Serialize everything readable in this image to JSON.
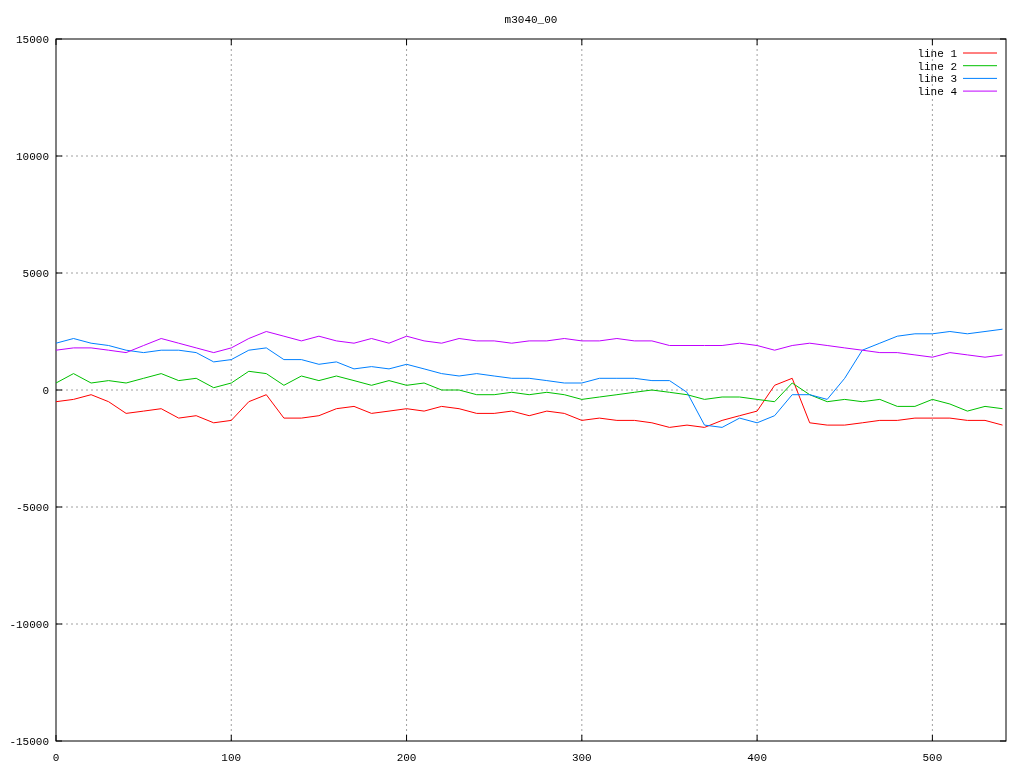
{
  "plot": {
    "chart_data": {
      "type": "line",
      "title": "m3040_00",
      "grid": true,
      "legend": true,
      "x": [
        0,
        10,
        20,
        30,
        40,
        50,
        60,
        70,
        80,
        90,
        100,
        110,
        120,
        130,
        140,
        150,
        160,
        170,
        180,
        190,
        200,
        210,
        220,
        230,
        240,
        250,
        260,
        270,
        280,
        290,
        300,
        310,
        320,
        330,
        340,
        350,
        360,
        370,
        380,
        390,
        400,
        410,
        420,
        430,
        440,
        450,
        460,
        470,
        480,
        490,
        500,
        510,
        520,
        530,
        540
      ],
      "xlim": [
        0,
        542
      ],
      "ylim": [
        -15000,
        15000
      ],
      "xticks": [
        0,
        100,
        200,
        300,
        400,
        500
      ],
      "yticks": [
        -15000,
        -10000,
        -5000,
        0,
        5000,
        10000,
        15000
      ],
      "series": [
        {
          "name": "line 1",
          "color": "#ff0000",
          "values": [
            -500,
            -400,
            -200,
            -500,
            -1000,
            -900,
            -800,
            -1200,
            -1100,
            -1400,
            -1300,
            -500,
            -200,
            -1200,
            -1200,
            -1100,
            -800,
            -700,
            -1000,
            -900,
            -800,
            -900,
            -700,
            -800,
            -1000,
            -1000,
            -900,
            -1100,
            -900,
            -1000,
            -1300,
            -1200,
            -1300,
            -1300,
            -1400,
            -1600,
            -1500,
            -1600,
            -1300,
            -1100,
            -900,
            200,
            500,
            -1400,
            -1500,
            -1500,
            -1400,
            -1300,
            -1300,
            -1200,
            -1200,
            -1200,
            -1300,
            -1300,
            -1500
          ]
        },
        {
          "name": "line 2",
          "color": "#00c000",
          "values": [
            300,
            700,
            300,
            400,
            300,
            500,
            700,
            400,
            500,
            100,
            300,
            800,
            700,
            200,
            600,
            400,
            600,
            400,
            200,
            400,
            200,
            300,
            0,
            0,
            -200,
            -200,
            -100,
            -200,
            -100,
            -200,
            -400,
            -300,
            -200,
            -100,
            0,
            -100,
            -200,
            -400,
            -300,
            -300,
            -400,
            -500,
            300,
            -200,
            -500,
            -400,
            -500,
            -400,
            -700,
            -700,
            -400,
            -600,
            -900,
            -700,
            -800
          ]
        },
        {
          "name": "line 3",
          "color": "#0080ff",
          "values": [
            2000,
            2200,
            2000,
            1900,
            1700,
            1600,
            1700,
            1700,
            1600,
            1200,
            1300,
            1700,
            1800,
            1300,
            1300,
            1100,
            1200,
            900,
            1000,
            900,
            1100,
            900,
            700,
            600,
            700,
            600,
            500,
            500,
            400,
            300,
            300,
            500,
            500,
            500,
            400,
            400,
            -100,
            -1500,
            -1600,
            -1200,
            -1400,
            -1100,
            -200,
            -200,
            -400,
            500,
            1700,
            2000,
            2300,
            2400,
            2400,
            2500,
            2400,
            2500,
            2600
          ]
        },
        {
          "name": "line 4",
          "color": "#c000ff",
          "values": [
            1700,
            1800,
            1800,
            1700,
            1600,
            1900,
            2200,
            2000,
            1800,
            1600,
            1800,
            2200,
            2500,
            2300,
            2100,
            2300,
            2100,
            2000,
            2200,
            2000,
            2300,
            2100,
            2000,
            2200,
            2100,
            2100,
            2000,
            2100,
            2100,
            2200,
            2100,
            2100,
            2200,
            2100,
            2100,
            1900,
            1900,
            1900,
            1900,
            2000,
            1900,
            1700,
            1900,
            2000,
            1900,
            1800,
            1700,
            1600,
            1600,
            1500,
            1400,
            1600,
            1500,
            1400,
            1500
          ]
        }
      ]
    }
  }
}
